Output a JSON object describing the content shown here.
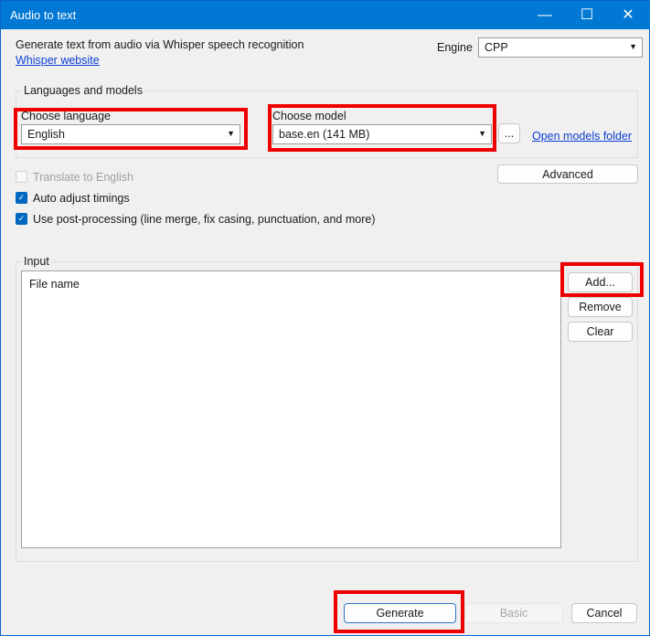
{
  "window": {
    "title": "Audio to text"
  },
  "header": {
    "description": "Generate text from audio via Whisper speech recognition",
    "website_link": "Whisper website",
    "engine_label": "Engine",
    "engine_value": "CPP"
  },
  "languages": {
    "group_label": "Languages and models",
    "language_label": "Choose language",
    "language_value": "English",
    "model_label": "Choose model",
    "model_value": "base.en (141 MB)",
    "browse_label": "...",
    "open_folder_link": "Open models folder"
  },
  "options": {
    "advanced_label": "Advanced",
    "translate": {
      "label": "Translate to English",
      "checked": false,
      "enabled": false
    },
    "auto_adjust": {
      "label": "Auto adjust timings",
      "checked": true
    },
    "post_processing": {
      "label": "Use post-processing (line merge, fix casing, punctuation, and more)",
      "checked": true
    }
  },
  "input": {
    "group_label": "Input",
    "column_header": "File name",
    "add_label": "Add...",
    "remove_label": "Remove",
    "clear_label": "Clear"
  },
  "footer": {
    "generate_label": "Generate",
    "basic_label": "Basic",
    "cancel_label": "Cancel"
  }
}
